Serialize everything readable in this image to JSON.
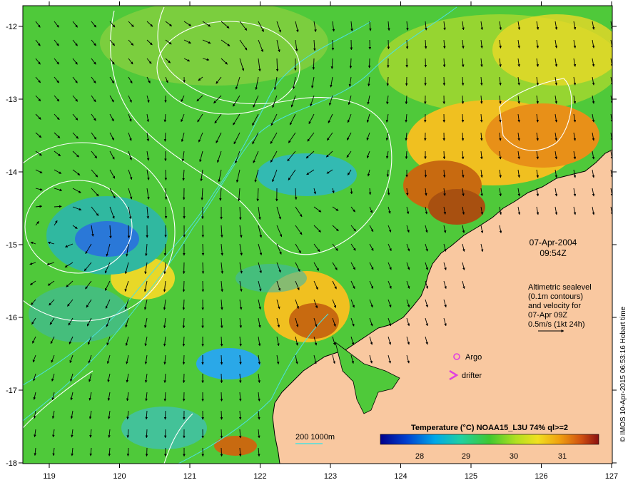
{
  "map": {
    "lon_ticks": [
      "119",
      "120",
      "121",
      "122",
      "123",
      "124",
      "125",
      "126",
      "127"
    ],
    "lat_ticks": [
      "-12",
      "-13",
      "-14",
      "-15",
      "-16",
      "-17",
      "-18"
    ],
    "date": "07-Apr-2004",
    "time": "09:54Z",
    "description_lines": [
      "Altimetric sealevel",
      "(0.1m contours)",
      "and velocity for",
      "07-Apr 09Z",
      "0.5m/s (1kt 24h)"
    ],
    "argo_label": "Argo",
    "drifter_label": "drifter",
    "depth_label": "200  1000m",
    "colorbar": {
      "title": "Temperature (°C) NOAA15_L3U 74% ql>=2",
      "ticks": [
        "28",
        "29",
        "30",
        "31"
      ]
    },
    "credit": "© IMOS 10-Apr-2015 06:53:16 Hobart time",
    "colors": {
      "land": "#f9c8a0",
      "warm_sst": "#c86a10",
      "mid_sst": "#4fc93a",
      "cool_sst": "#2aa8e8",
      "contour": "#ffffff",
      "isobath": "#4ce0e0",
      "argo": "#e040e0",
      "arrow": "#000000"
    }
  }
}
